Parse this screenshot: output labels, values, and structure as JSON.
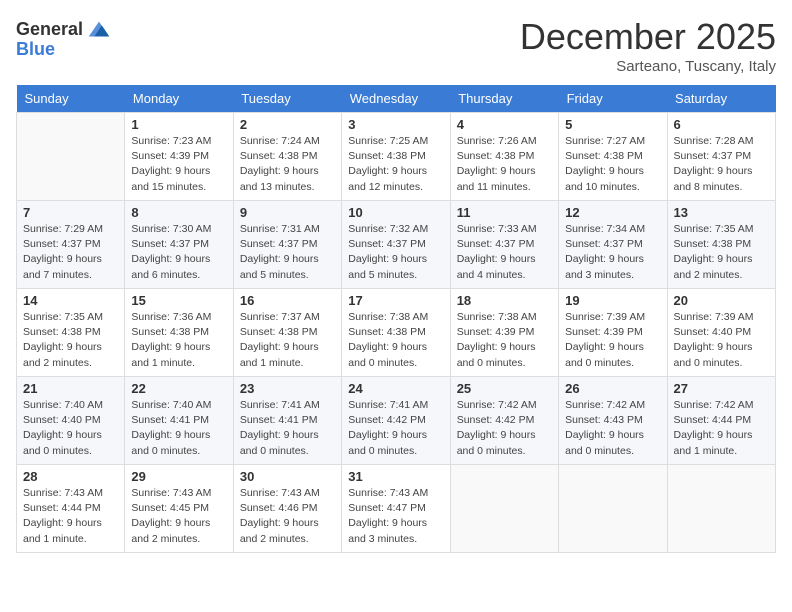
{
  "logo": {
    "line1": "General",
    "line2": "Blue"
  },
  "title": "December 2025",
  "subtitle": "Sarteano, Tuscany, Italy",
  "weekdays": [
    "Sunday",
    "Monday",
    "Tuesday",
    "Wednesday",
    "Thursday",
    "Friday",
    "Saturday"
  ],
  "weeks": [
    [
      {
        "day": "",
        "info": ""
      },
      {
        "day": "1",
        "info": "Sunrise: 7:23 AM\nSunset: 4:39 PM\nDaylight: 9 hours\nand 15 minutes."
      },
      {
        "day": "2",
        "info": "Sunrise: 7:24 AM\nSunset: 4:38 PM\nDaylight: 9 hours\nand 13 minutes."
      },
      {
        "day": "3",
        "info": "Sunrise: 7:25 AM\nSunset: 4:38 PM\nDaylight: 9 hours\nand 12 minutes."
      },
      {
        "day": "4",
        "info": "Sunrise: 7:26 AM\nSunset: 4:38 PM\nDaylight: 9 hours\nand 11 minutes."
      },
      {
        "day": "5",
        "info": "Sunrise: 7:27 AM\nSunset: 4:38 PM\nDaylight: 9 hours\nand 10 minutes."
      },
      {
        "day": "6",
        "info": "Sunrise: 7:28 AM\nSunset: 4:37 PM\nDaylight: 9 hours\nand 8 minutes."
      }
    ],
    [
      {
        "day": "7",
        "info": "Sunrise: 7:29 AM\nSunset: 4:37 PM\nDaylight: 9 hours\nand 7 minutes."
      },
      {
        "day": "8",
        "info": "Sunrise: 7:30 AM\nSunset: 4:37 PM\nDaylight: 9 hours\nand 6 minutes."
      },
      {
        "day": "9",
        "info": "Sunrise: 7:31 AM\nSunset: 4:37 PM\nDaylight: 9 hours\nand 5 minutes."
      },
      {
        "day": "10",
        "info": "Sunrise: 7:32 AM\nSunset: 4:37 PM\nDaylight: 9 hours\nand 5 minutes."
      },
      {
        "day": "11",
        "info": "Sunrise: 7:33 AM\nSunset: 4:37 PM\nDaylight: 9 hours\nand 4 minutes."
      },
      {
        "day": "12",
        "info": "Sunrise: 7:34 AM\nSunset: 4:37 PM\nDaylight: 9 hours\nand 3 minutes."
      },
      {
        "day": "13",
        "info": "Sunrise: 7:35 AM\nSunset: 4:38 PM\nDaylight: 9 hours\nand 2 minutes."
      }
    ],
    [
      {
        "day": "14",
        "info": "Sunrise: 7:35 AM\nSunset: 4:38 PM\nDaylight: 9 hours\nand 2 minutes."
      },
      {
        "day": "15",
        "info": "Sunrise: 7:36 AM\nSunset: 4:38 PM\nDaylight: 9 hours\nand 1 minute."
      },
      {
        "day": "16",
        "info": "Sunrise: 7:37 AM\nSunset: 4:38 PM\nDaylight: 9 hours\nand 1 minute."
      },
      {
        "day": "17",
        "info": "Sunrise: 7:38 AM\nSunset: 4:38 PM\nDaylight: 9 hours\nand 0 minutes."
      },
      {
        "day": "18",
        "info": "Sunrise: 7:38 AM\nSunset: 4:39 PM\nDaylight: 9 hours\nand 0 minutes."
      },
      {
        "day": "19",
        "info": "Sunrise: 7:39 AM\nSunset: 4:39 PM\nDaylight: 9 hours\nand 0 minutes."
      },
      {
        "day": "20",
        "info": "Sunrise: 7:39 AM\nSunset: 4:40 PM\nDaylight: 9 hours\nand 0 minutes."
      }
    ],
    [
      {
        "day": "21",
        "info": "Sunrise: 7:40 AM\nSunset: 4:40 PM\nDaylight: 9 hours\nand 0 minutes."
      },
      {
        "day": "22",
        "info": "Sunrise: 7:40 AM\nSunset: 4:41 PM\nDaylight: 9 hours\nand 0 minutes."
      },
      {
        "day": "23",
        "info": "Sunrise: 7:41 AM\nSunset: 4:41 PM\nDaylight: 9 hours\nand 0 minutes."
      },
      {
        "day": "24",
        "info": "Sunrise: 7:41 AM\nSunset: 4:42 PM\nDaylight: 9 hours\nand 0 minutes."
      },
      {
        "day": "25",
        "info": "Sunrise: 7:42 AM\nSunset: 4:42 PM\nDaylight: 9 hours\nand 0 minutes."
      },
      {
        "day": "26",
        "info": "Sunrise: 7:42 AM\nSunset: 4:43 PM\nDaylight: 9 hours\nand 0 minutes."
      },
      {
        "day": "27",
        "info": "Sunrise: 7:42 AM\nSunset: 4:44 PM\nDaylight: 9 hours\nand 1 minute."
      }
    ],
    [
      {
        "day": "28",
        "info": "Sunrise: 7:43 AM\nSunset: 4:44 PM\nDaylight: 9 hours\nand 1 minute."
      },
      {
        "day": "29",
        "info": "Sunrise: 7:43 AM\nSunset: 4:45 PM\nDaylight: 9 hours\nand 2 minutes."
      },
      {
        "day": "30",
        "info": "Sunrise: 7:43 AM\nSunset: 4:46 PM\nDaylight: 9 hours\nand 2 minutes."
      },
      {
        "day": "31",
        "info": "Sunrise: 7:43 AM\nSunset: 4:47 PM\nDaylight: 9 hours\nand 3 minutes."
      },
      {
        "day": "",
        "info": ""
      },
      {
        "day": "",
        "info": ""
      },
      {
        "day": "",
        "info": ""
      }
    ]
  ]
}
